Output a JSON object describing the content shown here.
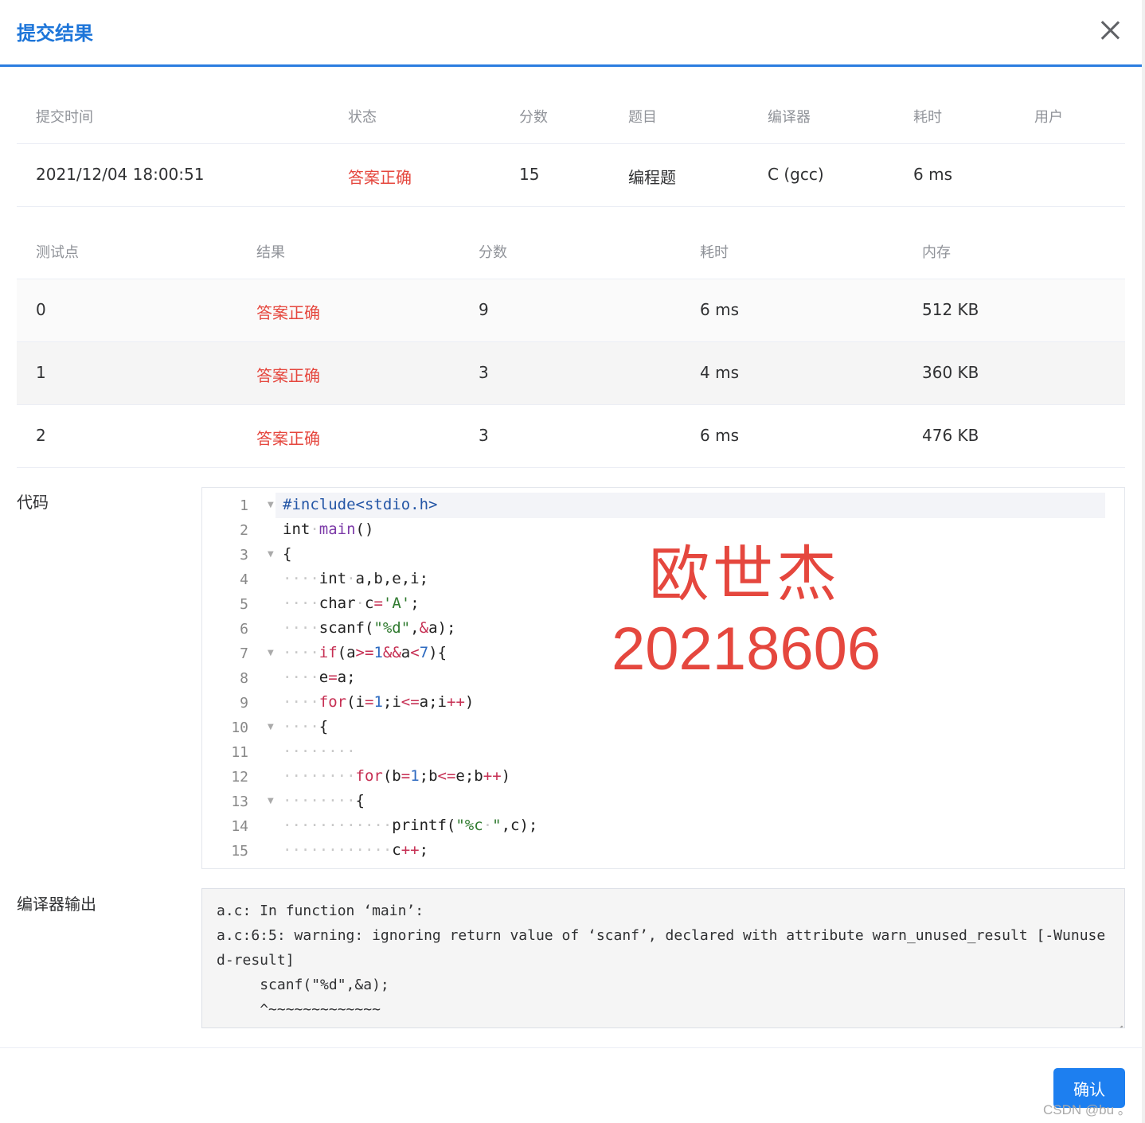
{
  "dialog": {
    "title": "提交结果",
    "close_icon": "close-icon"
  },
  "summary": {
    "headers": [
      "提交时间",
      "状态",
      "分数",
      "题目",
      "编译器",
      "耗时",
      "用户"
    ],
    "values": [
      "2021/12/04 18:00:51",
      "答案正确",
      "15",
      "编程题",
      "C (gcc)",
      "6 ms",
      ""
    ]
  },
  "tests": {
    "headers": [
      "测试点",
      "结果",
      "分数",
      "耗时",
      "内存"
    ],
    "rows": [
      [
        "0",
        "答案正确",
        "9",
        "6 ms",
        "512 KB"
      ],
      [
        "1",
        "答案正确",
        "3",
        "4 ms",
        "360 KB"
      ],
      [
        "2",
        "答案正确",
        "3",
        "6 ms",
        "476 KB"
      ]
    ]
  },
  "code": {
    "label": "代码",
    "line_numbers": [
      "1",
      "2",
      "3",
      "4",
      "5",
      "6",
      "7",
      "8",
      "9",
      "10",
      "11",
      "12",
      "13",
      "14",
      "15"
    ]
  },
  "watermark": {
    "name": "欧世杰",
    "id": "20218606"
  },
  "compiler_output": {
    "label": "编译器输出",
    "lines": [
      "a.c: In function ‘main’:",
      "a.c:6:5: warning: ignoring return value of ‘scanf’, declared with attribute warn_unused_result [-Wunused-result]",
      "     scanf(\"%d\",&a);",
      "     ^~~~~~~~~~~~~~"
    ]
  },
  "footer": {
    "confirm_label": "确认",
    "credit": "CSDN @bu 。"
  },
  "colors": {
    "accent": "#1d75d9",
    "status_ok": "#e5473e",
    "button": "#1d7ff0"
  }
}
